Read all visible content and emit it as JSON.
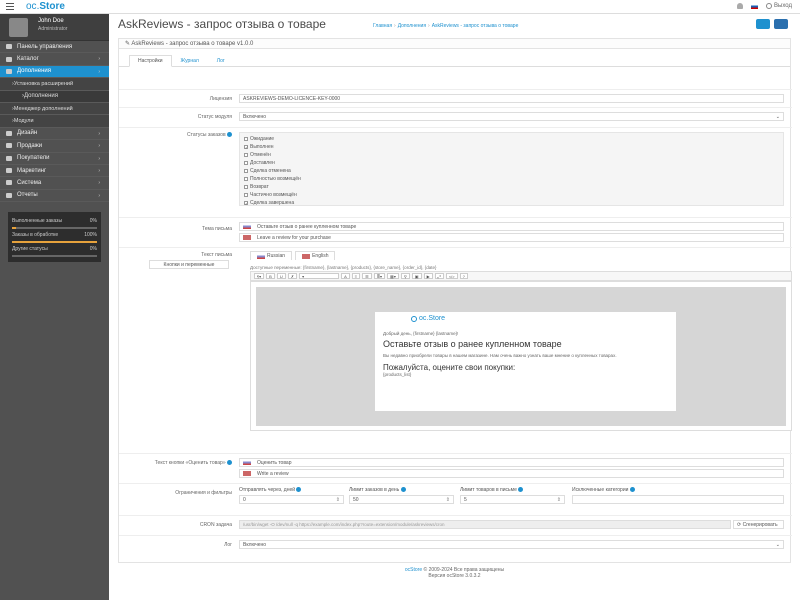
{
  "topbar": {
    "logo_text": "oc",
    "logo_store": "Store",
    "flag": "ru",
    "logout": "Выход"
  },
  "sidebar": {
    "user_name": "John Doe",
    "user_role": "Administrator",
    "items": [
      {
        "label": "Панель управления",
        "arrow": ""
      },
      {
        "label": "Каталог",
        "arrow": "›"
      },
      {
        "label": "Дополнения",
        "arrow": "›",
        "active": true
      },
      {
        "label": "Установка расширений",
        "sub": true
      },
      {
        "label": "Дополнения",
        "sub2": true
      },
      {
        "label": "Менеджер дополнений",
        "sub": true
      },
      {
        "label": "Модули",
        "sub": true
      },
      {
        "label": "Дизайн",
        "arrow": "›"
      },
      {
        "label": "Продажи",
        "arrow": "›"
      },
      {
        "label": "Покупатели",
        "arrow": "›"
      },
      {
        "label": "Маркетинг",
        "arrow": "›"
      },
      {
        "label": "Система",
        "arrow": "›"
      },
      {
        "label": "Отчеты",
        "arrow": "›"
      }
    ],
    "stats": [
      {
        "label": "Выполненные заказы",
        "value": "0%",
        "fill": 0.05
      },
      {
        "label": "Заказы в обработке",
        "value": "100%",
        "fill": 1.0
      },
      {
        "label": "Другие статусы",
        "value": "0%",
        "fill": 0.0
      }
    ]
  },
  "header": {
    "title": "AskReviews - запрос отзыва о товаре",
    "bc_home": "Главная",
    "bc_ext": "Дополнения",
    "bc_mod": "AskReviews - запрос отзыва о товаре"
  },
  "panel": {
    "heading": "AskReviews - запрос отзыва о товаре v1.0.0",
    "tabs": [
      "Настройки",
      "Журнал",
      "Лог"
    ],
    "licence_label": "Лицензия",
    "licence_value": "ASKREVIEWS-DEMO-LICENCE-KEY-0000",
    "status_label": "Статус модуля",
    "status_value": "Включено",
    "order_status_label": "Статусы заказов",
    "order_statuses": [
      {
        "label": "Ожидание",
        "checked": false
      },
      {
        "label": "Выполнен",
        "checked": true
      },
      {
        "label": "Отменён",
        "checked": false
      },
      {
        "label": "Доставлен",
        "checked": false
      },
      {
        "label": "Сделка отменена",
        "checked": false
      },
      {
        "label": "Полностью возмещён",
        "checked": false
      },
      {
        "label": "Возврат",
        "checked": false
      },
      {
        "label": "Частично возмещён",
        "checked": false
      },
      {
        "label": "Сделка завершена",
        "checked": true
      }
    ],
    "subject_label": "Тема письма",
    "subject_ru": "Оставьте отзыв о ранее купленном товаре",
    "subject_en": "Leave a review for your purchase",
    "body_label": "Текст письма",
    "body_hint": "Кнопки и переменные",
    "lang_ru": "Russian",
    "lang_en": "English",
    "editor_hint": "Доступные переменные: {firstname}, {lastname}, {products}, {store_name}, {order_id}, {date}",
    "email_logo": "oc.Store",
    "email_greeting": "Добрый день, {firstname} {lastname}!",
    "email_h1": "Оставьте отзыв о ранее купленном товаре",
    "email_p": "Вы недавно приобрели товары в нашем магазине. Нам очень важно узнать ваше мнение о купленных товарах.",
    "email_h2": "Пожалуйста, оцените свои покупки:",
    "email_link": "{products_list}",
    "button_label": "Текст кнопки «Оценить товар»",
    "button_ru": "Оценить товар",
    "button_en": "Write a review",
    "limits_label": "Ограничения и фильтры",
    "lim1_label": "Отправлять через, дней",
    "lim1_value": "0",
    "lim2_label": "Лимит заказов в день",
    "lim2_value": "50",
    "lim3_label": "Лимит товаров в письме",
    "lim3_value": "5",
    "lim4_label": "Исключенные категории",
    "lim4_value": "",
    "cron_label": "CRON задача",
    "cron_value": "/usr/bin/wget -O /dev/null -q https://example.com/index.php?route=extension/module/askreviews/cron",
    "cron_btn": "Сгенерировать",
    "log_label": "Лог",
    "log_value": "Включено"
  },
  "footer": {
    "link": "ocStore",
    "line1": "© 2009-2024 Все права защищены",
    "line2": "Версия ocStore 3.0.3.2"
  }
}
